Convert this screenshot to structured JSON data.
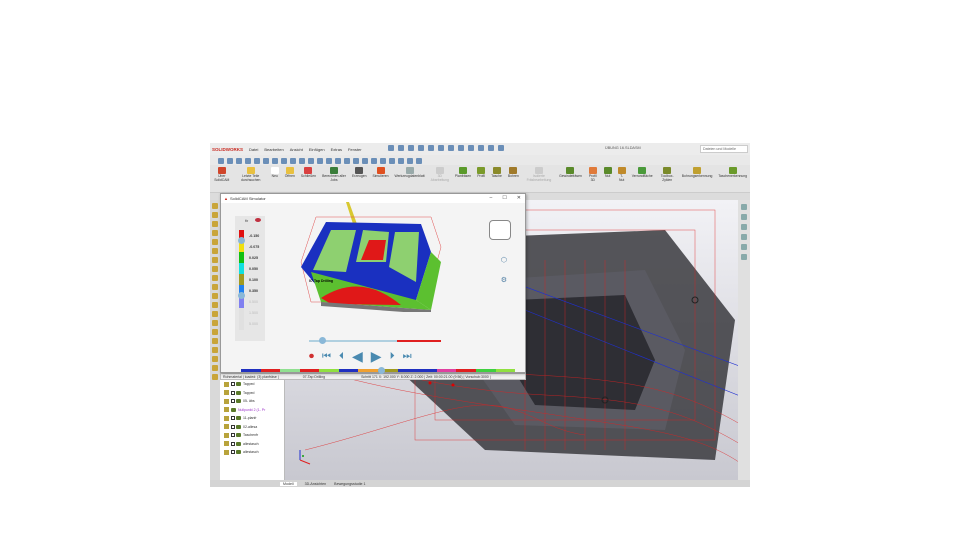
{
  "app": {
    "brand": "SOLIDWORKS",
    "menu": [
      "Datei",
      "Bearbeiten",
      "Ansicht",
      "Einfügen",
      "Extras",
      "Fenster"
    ],
    "doc_title": "ÜBUNG 16.SLDASM",
    "search_placeholder": "Dateien und Modelle"
  },
  "ribbon": [
    {
      "label": "Über SolidCAM",
      "color": "#d0452a"
    },
    {
      "label": "Letzte Teile durchsuchen",
      "color": "#e8c040"
    },
    {
      "label": "Neu",
      "color": "#ffffff"
    },
    {
      "label": "Öffnen",
      "color": "#e8c040"
    },
    {
      "label": "Schließen",
      "color": "#d94040"
    },
    {
      "label": "Berechnen aller Jobs",
      "color": "#3a7d3a"
    },
    {
      "label": "Erzeugen",
      "color": "#555555"
    },
    {
      "label": "Simulieren",
      "color": "#e05020"
    },
    {
      "label": "Werkzeugdatenblatt",
      "color": "#9aa"
    },
    {
      "label": "3D Abarbeitung",
      "color": "#ccc",
      "disabled": true
    },
    {
      "label": "Planfräsen",
      "color": "#5a9a2a"
    },
    {
      "label": "Profil",
      "color": "#7a9a2a"
    },
    {
      "label": "Tasche",
      "color": "#8a8a2a"
    },
    {
      "label": "Bohren",
      "color": "#a07a2a"
    },
    {
      "label": "Isolierte Fräsbearbeitung",
      "color": "#ccc",
      "disabled": true
    },
    {
      "label": "Gewindefräsen",
      "color": "#5a8a2a"
    },
    {
      "label": "Profil 3D",
      "color": "#e07a3a"
    },
    {
      "label": "Nut",
      "color": "#5a8a2a"
    },
    {
      "label": "T-Nut",
      "color": "#c08a2a"
    },
    {
      "label": "Verrundfläche",
      "color": "#4a9a3a"
    },
    {
      "label": "Toolbox-Zyklen",
      "color": "#7a8a2a"
    },
    {
      "label": "Bohrungserkennung",
      "color": "#c0a030"
    },
    {
      "label": "Taschenerkennung",
      "color": "#6a9a2a"
    }
  ],
  "simulator": {
    "title": "SolidCAM Simulator",
    "legend": [
      {
        "value": "-0.150",
        "color": "#e01010",
        "dim": false
      },
      {
        "value": "-0.075",
        "color": "#f0e010",
        "dim": false
      },
      {
        "value": "0.025",
        "color": "#10c010",
        "dim": false
      },
      {
        "value": "0.050",
        "color": "#10e0e0",
        "dim": false
      },
      {
        "value": "0.100",
        "color": "#a09a20",
        "dim": false
      },
      {
        "value": "0.350",
        "color": "#2080f0",
        "dim": false
      },
      {
        "value": "0.500",
        "color": "#8080f0",
        "dim": true
      },
      {
        "value": "1.500",
        "color": "#e0e0e0",
        "dim": true
      },
      {
        "value": "5.000",
        "color": "#e0e0e0",
        "dim": true
      }
    ],
    "op_label": "07-Tap Drilling",
    "progress": 0.1,
    "timeline_position": 0.5,
    "timeline_colors": [
      "#2030c0",
      "#e02020",
      "#90e090",
      "#e02020",
      "#90e040",
      "#2030c0",
      "#f0a030",
      "#a09a20",
      "#2030c0",
      "#2030c0",
      "#e040a0",
      "#e02020",
      "#40d040",
      "#90e040"
    ]
  },
  "status": {
    "stock": "Rohmaterial | loaded: (3) planfräse |",
    "operation": "07-Tap Drilling",
    "readout": "Schritt 171 X: 192.000 Y: 8.000 Z: 2.000 | Zeit: 00:00:21.00 (9:56) | Vorschub:3000 |"
  },
  "tree": [
    {
      "label": "Tapped",
      "type": "op"
    },
    {
      "label": "Tapped",
      "type": "op"
    },
    {
      "label": "05- äbs",
      "type": "op"
    },
    {
      "label": "Nullpunkt 2 (1- Pr",
      "type": "origin"
    },
    {
      "label": "11-planfr",
      "type": "op"
    },
    {
      "label": "02-allesa",
      "type": "op"
    },
    {
      "label": "Taschenfr",
      "type": "op"
    },
    {
      "label": "allestasch",
      "type": "op"
    },
    {
      "label": "allestasch",
      "type": "op"
    }
  ],
  "bottom_tabs": [
    "Modell",
    "3D-Ansichten",
    "Bewegungsstudie 1"
  ]
}
